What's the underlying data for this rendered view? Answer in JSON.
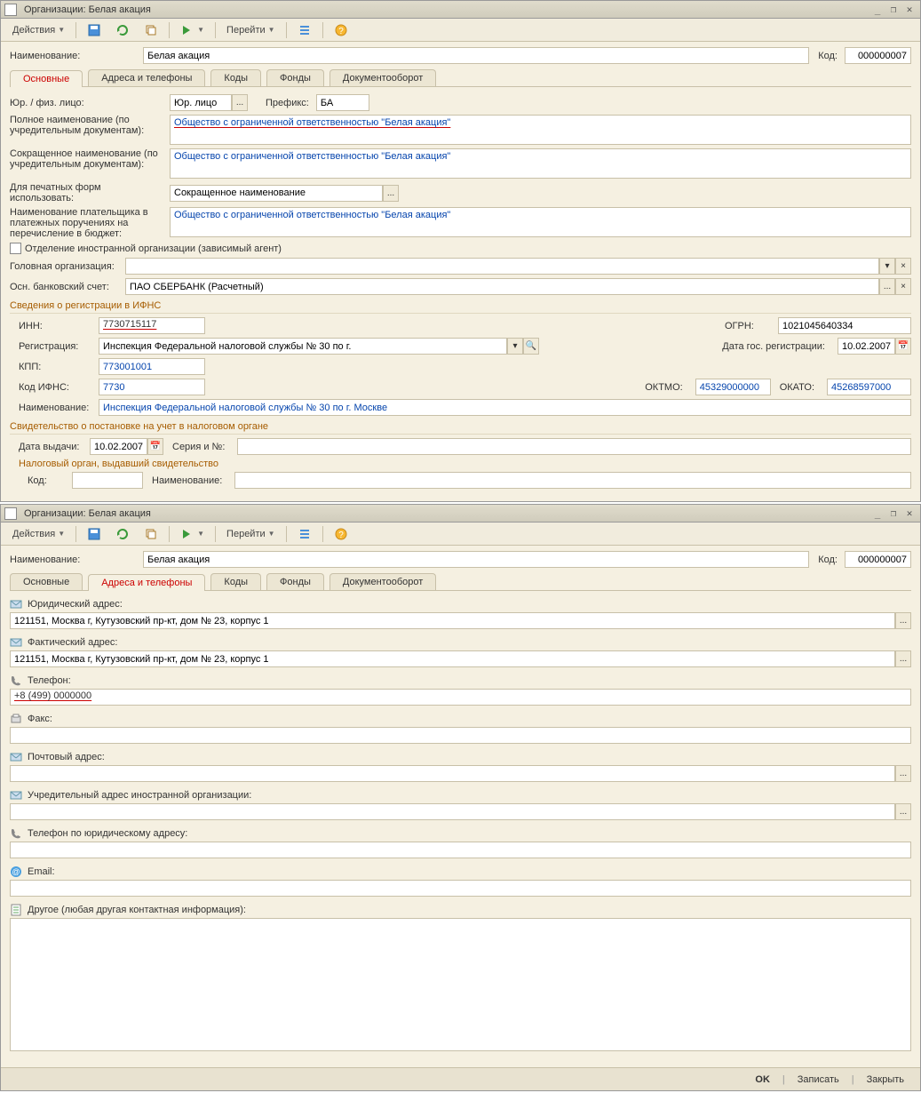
{
  "window1": {
    "title": "Организации: Белая акация",
    "toolbar": {
      "actions": "Действия",
      "goto": "Перейти"
    },
    "name_label": "Наименование:",
    "name_value": "Белая акация",
    "code_label": "Код:",
    "code_value": "000000007",
    "tabs": {
      "t1": "Основные",
      "t2": "Адреса и телефоны",
      "t3": "Коды",
      "t4": "Фонды",
      "t5": "Документооборот"
    },
    "main": {
      "entity_label": "Юр. / физ. лицо:",
      "entity_value": "Юр. лицо",
      "prefix_label": "Префикс:",
      "prefix_value": "БА",
      "fullname_label": "Полное наименование (по учредительным документам):",
      "fullname_value": "Общество с ограниченной ответственностью \"Белая акация\"",
      "shortname_label": "Сокращенное наименование (по учредительным документам):",
      "shortname_value": "Общество с ограниченной ответственностью \"Белая акация\"",
      "printform_label": "Для печатных форм использовать:",
      "printform_value": "Сокращенное наименование",
      "payer_label": "Наименование плательщика в платежных поручениях на перечисление в бюджет:",
      "payer_value": "Общество с ограниченной ответственностью \"Белая акация\"",
      "foreign_label": "Отделение иностранной организации (зависимый агент)",
      "head_org_label": "Головная организация:",
      "bank_label": "Осн. банковский счет:",
      "bank_value": "ПАО СБЕРБАНК (Расчетный)"
    },
    "ifns": {
      "section": "Сведения о регистрации в ИФНС",
      "inn_label": "ИНН:",
      "inn_value": "7730715117",
      "ogrn_label": "ОГРН:",
      "ogrn_value": "1021045640334",
      "reg_label": "Регистрация:",
      "reg_value": "Инспекция Федеральной налоговой службы № 30 по г.",
      "regdate_label": "Дата гос. регистрации:",
      "regdate_value": "10.02.2007",
      "kpp_label": "КПП:",
      "kpp_value": "773001001",
      "ifnscode_label": "Код ИФНС:",
      "ifnscode_value": "7730",
      "oktmo_label": "ОКТМО:",
      "oktmo_value": "45329000000",
      "okato_label": "ОКАТО:",
      "okato_value": "45268597000",
      "ifnsname_label": "Наименование:",
      "ifnsname_value": "Инспекция Федеральной налоговой службы № 30 по г. Москве"
    },
    "cert": {
      "section": "Свидетельство о постановке на учет в налоговом органе",
      "date_label": "Дата выдачи:",
      "date_value": "10.02.2007",
      "series_label": "Серия и №:",
      "authority": "Налоговый орган, выдавший свидетельство",
      "code_label": "Код:",
      "name_label": "Наименование:"
    }
  },
  "window2": {
    "title": "Организации: Белая акация",
    "toolbar": {
      "actions": "Действия",
      "goto": "Перейти"
    },
    "name_label": "Наименование:",
    "name_value": "Белая акация",
    "code_label": "Код:",
    "code_value": "000000007",
    "tabs": {
      "t1": "Основные",
      "t2": "Адреса и телефоны",
      "t3": "Коды",
      "t4": "Фонды",
      "t5": "Документооборот"
    },
    "addr": {
      "legal_label": "Юридический адрес:",
      "legal_value": "121151, Москва г, Кутузовский пр-кт, дом № 23, корпус 1",
      "actual_label": "Фактический адрес:",
      "actual_value": "121151, Москва г, Кутузовский пр-кт, дом № 23, корпус 1",
      "phone_label": "Телефон:",
      "phone_value": "+8 (499) 0000000",
      "fax_label": "Факс:",
      "postal_label": "Почтовый адрес:",
      "foreign_label": "Учредительный адрес иностранной организации:",
      "legalphone_label": "Телефон по юридическому адресу:",
      "email_label": "Email:",
      "other_label": "Другое (любая другая контактная информация):"
    },
    "footer": {
      "ok": "OK",
      "save": "Записать",
      "close": "Закрыть"
    }
  }
}
